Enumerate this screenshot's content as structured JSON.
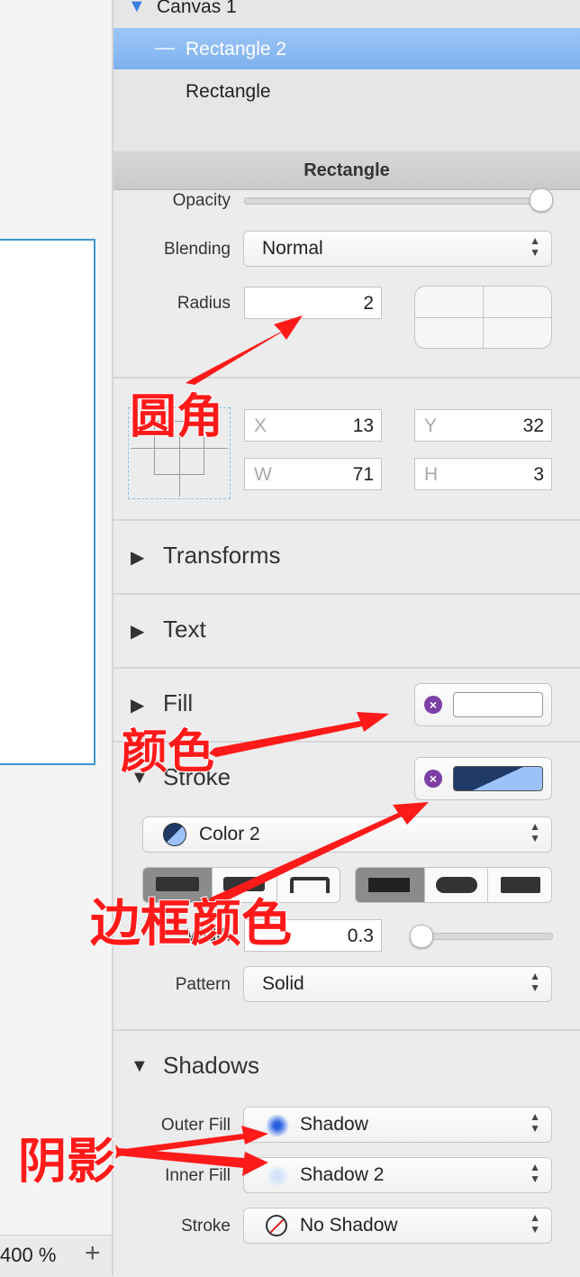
{
  "layers": {
    "canvas": "Canvas 1",
    "selected": "Rectangle 2",
    "other": "Rectangle"
  },
  "inspector": {
    "title": "Rectangle",
    "opacity_label": "Opacity",
    "opacity_value": 1.0,
    "blending_label": "Blending",
    "blending_value": "Normal",
    "radius_label": "Radius",
    "radius_value": "2",
    "x_label": "X",
    "x_value": "13",
    "y_label": "Y",
    "y_value": "32",
    "w_label": "W",
    "w_value": "71",
    "h_label": "H",
    "h_value": "3"
  },
  "sections": {
    "transforms": "Transforms",
    "text": "Text",
    "fill": "Fill",
    "stroke": "Stroke",
    "shadows": "Shadows"
  },
  "stroke": {
    "color_name": "Color 2",
    "width_label": "Width",
    "width_value": "0.3",
    "pattern_label": "Pattern",
    "pattern_value": "Solid"
  },
  "shadows": {
    "outer_label": "Outer Fill",
    "outer_value": "Shadow",
    "inner_label": "Inner Fill",
    "inner_value": "Shadow 2",
    "stroke_label": "Stroke",
    "stroke_value": "No Shadow"
  },
  "canvas_footer": {
    "zoom": "400 %",
    "plus": "+"
  },
  "annotations": {
    "radius": "圆角",
    "fill_color": "颜色",
    "border_color": "边框颜色",
    "shadow": "阴影"
  },
  "colors": {
    "selection": "#8ebcf3",
    "artboard_border": "#3d97d3",
    "stroke_dark": "#1f3a66",
    "stroke_light": "#9cc2f8",
    "remove_dot": "#7b3fa6",
    "annotation": "#ff1a1a"
  }
}
